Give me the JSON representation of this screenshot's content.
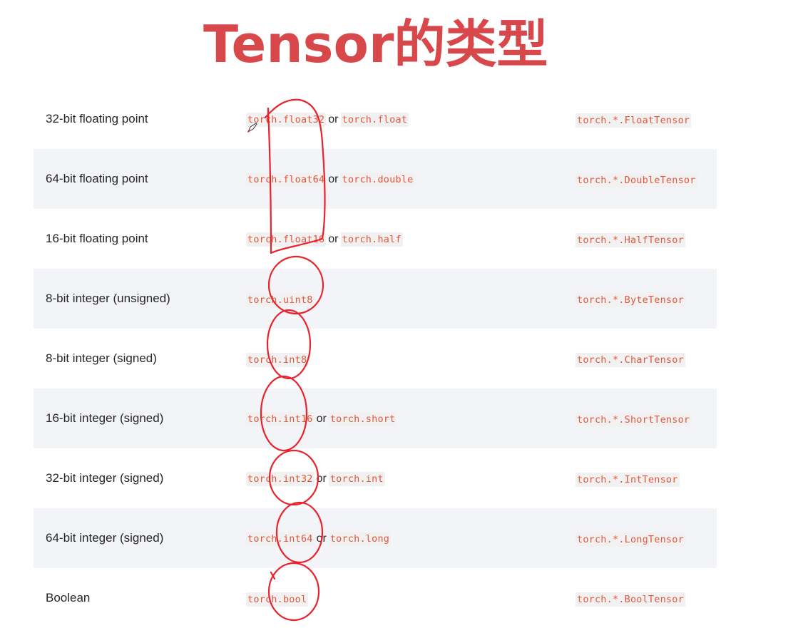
{
  "title": "Tensor的类型",
  "connector": "or",
  "rows": [
    {
      "desc": "32-bit floating point",
      "dtype": "torch.float32",
      "alias": "torch.float",
      "tensor": "torch.*.FloatTensor"
    },
    {
      "desc": "64-bit floating point",
      "dtype": "torch.float64",
      "alias": "torch.double",
      "tensor": "torch.*.DoubleTensor"
    },
    {
      "desc": "16-bit floating point",
      "dtype": "torch.float16",
      "alias": "torch.half",
      "tensor": "torch.*.HalfTensor"
    },
    {
      "desc": "8-bit integer (unsigned)",
      "dtype": "torch.uint8",
      "alias": "",
      "tensor": "torch.*.ByteTensor"
    },
    {
      "desc": "8-bit integer (signed)",
      "dtype": "torch.int8",
      "alias": "",
      "tensor": "torch.*.CharTensor"
    },
    {
      "desc": "16-bit integer (signed)",
      "dtype": "torch.int16",
      "alias": "torch.short",
      "tensor": "torch.*.ShortTensor"
    },
    {
      "desc": "32-bit integer (signed)",
      "dtype": "torch.int32",
      "alias": "torch.int",
      "tensor": "torch.*.IntTensor"
    },
    {
      "desc": "64-bit integer (signed)",
      "dtype": "torch.int64",
      "alias": "torch.long",
      "tensor": "torch.*.LongTensor"
    },
    {
      "desc": "Boolean",
      "dtype": "torch.bool",
      "alias": "",
      "tensor": "torch.*.BoolTensor"
    }
  ],
  "colors": {
    "title": "#d8474a",
    "code_text": "#e3573b",
    "code_bg": "#f1f1f1",
    "stripe": "#f3f4f7",
    "annotation": "#e8232b"
  },
  "icons": {
    "cursor": "pen-cursor-icon"
  }
}
